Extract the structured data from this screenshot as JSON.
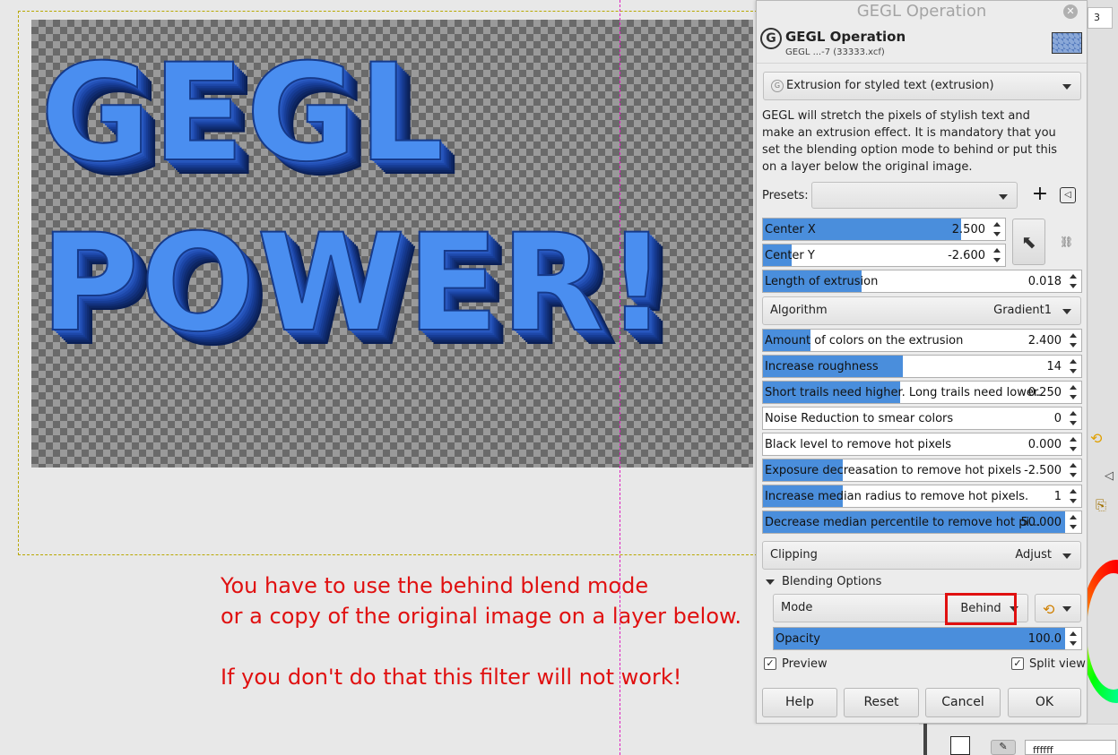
{
  "canvas": {
    "art_line_1": "GEGL",
    "art_line_2": "POWER!",
    "notes": [
      "You have to use the behind blend mode",
      "or a copy of the original image on a layer below.",
      "If you don't do that this filter will not work!"
    ],
    "note_color": "#e01010"
  },
  "dock": {
    "spin_value": "3",
    "hex_value": "ffffff"
  },
  "dialog": {
    "window_title": "GEGL Operation",
    "header_title": "GEGL Operation",
    "header_sub": "GEGL ...-7 (33333.xcf)",
    "operation": "Extrusion for styled text (extrusion)",
    "description": "GEGL will stretch the pixels of stylish text and make an extrusion effect. It is mandatory that you set the blending option mode to behind or put this on a layer below the original image.",
    "presets_label": "Presets:",
    "presets_value": "",
    "add_preset": "+",
    "params": [
      {
        "label": "Center X",
        "value": "2.500",
        "fill": 0.82
      },
      {
        "label": "Center Y",
        "value": "-2.600",
        "fill": 0.12
      },
      {
        "label": "Length of extrusion",
        "value": "0.018",
        "fill": 0.31
      },
      {
        "label": "Amount of colors on the extrusion",
        "value": "2.400",
        "fill": 0.15
      },
      {
        "label": "Increase roughness",
        "value": "14",
        "fill": 0.44
      },
      {
        "label": "Short trails need higher. Long trails need lower.",
        "value": "0.250",
        "fill": 0.43
      },
      {
        "label": "Noise Reduction to smear colors",
        "value": "0",
        "fill": 0
      },
      {
        "label": "Black level to remove hot pixels",
        "value": "0.000",
        "fill": 0
      },
      {
        "label": "Exposure decreasation to remove hot pixels",
        "value": "-2.500",
        "fill": 0.25
      },
      {
        "label": "Increase  median radius to remove hot pixels.",
        "value": "1",
        "fill": 0.25
      },
      {
        "label": "Decrease median percentile to remove hot pi...",
        "value": "50.000",
        "fill": 1.0
      }
    ],
    "algorithm_label": "Algorithm",
    "algorithm_value": "Gradient1",
    "clipping_label": "Clipping",
    "clipping_value": "Adjust",
    "blending_header": "Blending Options",
    "mode_label": "Mode",
    "mode_value": "Behind",
    "opacity_label": "Opacity",
    "opacity_value": "100.0",
    "preview_label": "Preview",
    "split_label": "Split view",
    "preview_checked": true,
    "split_checked": true,
    "buttons": {
      "help": "Help",
      "reset": "Reset",
      "cancel": "Cancel",
      "ok": "OK"
    },
    "accent_color": "#4a8edc",
    "highlight_color": "#e01010"
  }
}
